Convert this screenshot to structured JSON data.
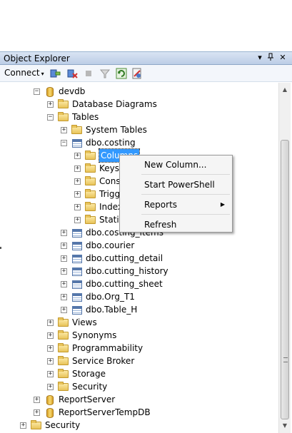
{
  "panel": {
    "title": "Object Explorer",
    "pin": "▾",
    "dock": "ꟷ",
    "close": "✕"
  },
  "toolbar": {
    "connect": "Connect",
    "caret": "▾"
  },
  "tree": [
    {
      "label": "devdb",
      "icon": "database-icon",
      "sign": "−"
    },
    {
      "label": "Database Diagrams",
      "icon": "folder-icon",
      "sign": "+"
    },
    {
      "label": "Tables",
      "icon": "folder-icon",
      "sign": "−"
    },
    {
      "label": "System Tables",
      "icon": "folder-icon",
      "sign": "+"
    },
    {
      "label": "dbo.costing",
      "icon": "table-icon",
      "sign": "−"
    },
    {
      "label": "Columns",
      "icon": "folder-icon",
      "sign": "+"
    },
    {
      "label": "Keys",
      "icon": "folder-icon",
      "sign": "+"
    },
    {
      "label": "Cons",
      "icon": "folder-icon",
      "sign": "+"
    },
    {
      "label": "Trigg",
      "icon": "folder-icon",
      "sign": "+"
    },
    {
      "label": "Index",
      "icon": "folder-icon",
      "sign": "+"
    },
    {
      "label": "Statis",
      "icon": "folder-icon",
      "sign": "+"
    },
    {
      "label": "dbo.costing_items",
      "icon": "table-icon",
      "sign": "+"
    },
    {
      "label": "dbo.courier",
      "icon": "table-icon",
      "sign": "+"
    },
    {
      "label": "dbo.cutting_detail",
      "icon": "table-icon",
      "sign": "+"
    },
    {
      "label": "dbo.cutting_history",
      "icon": "table-icon",
      "sign": "+"
    },
    {
      "label": "dbo.cutting_sheet",
      "icon": "table-icon",
      "sign": "+"
    },
    {
      "label": "dbo.Org_T1",
      "icon": "table-icon",
      "sign": "+"
    },
    {
      "label": "dbo.Table_H",
      "icon": "table-icon",
      "sign": "+"
    },
    {
      "label": "Views",
      "icon": "folder-icon",
      "sign": "+"
    },
    {
      "label": "Synonyms",
      "icon": "folder-icon",
      "sign": "+"
    },
    {
      "label": "Programmability",
      "icon": "folder-icon",
      "sign": "+"
    },
    {
      "label": "Service Broker",
      "icon": "folder-icon",
      "sign": "+"
    },
    {
      "label": "Storage",
      "icon": "folder-icon",
      "sign": "+"
    },
    {
      "label": "Security",
      "icon": "folder-icon",
      "sign": "+"
    },
    {
      "label": "ReportServer",
      "icon": "database-icon",
      "sign": "+"
    },
    {
      "label": "ReportServerTempDB",
      "icon": "database-icon",
      "sign": "+"
    },
    {
      "label": "Security",
      "icon": "folder-icon",
      "sign": "+"
    }
  ],
  "context_menu": {
    "items": [
      "New Column...",
      "Start PowerShell",
      "Reports",
      "Refresh"
    ],
    "submenu_arrow": "▶"
  },
  "colors": {
    "selection": "#3399ff",
    "title_bar": "#bccde6"
  }
}
